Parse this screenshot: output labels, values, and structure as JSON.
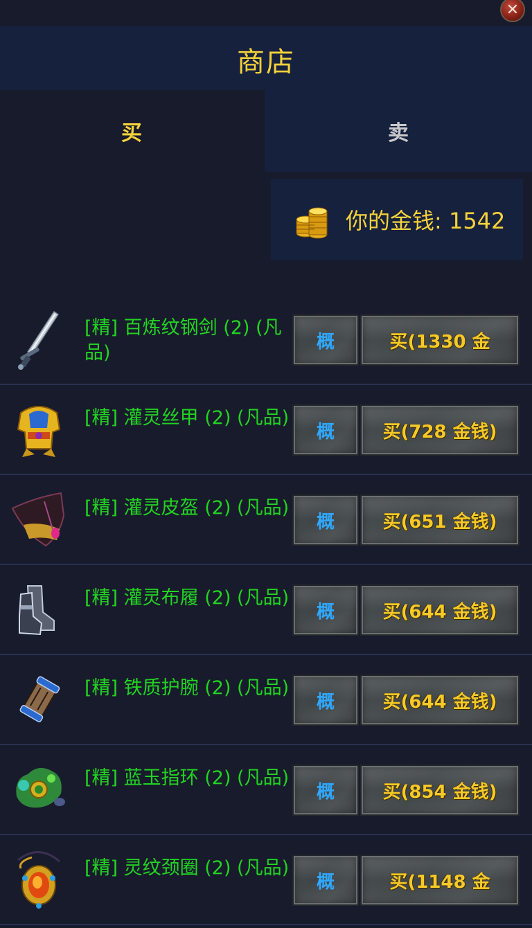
{
  "window": {
    "title": "商店",
    "close_icon": "close-x-icon"
  },
  "tabs": {
    "buy": "买",
    "sell": "卖"
  },
  "money": {
    "label": "你的金钱: 1542",
    "icon": "gold-coins-icon"
  },
  "items": [
    {
      "name": "品)",
      "detail_label": "",
      "buy_label": "",
      "icon": "amber-gem-icon"
    },
    {
      "name": "[精] 百炼纹钢剑 (2) (凡品)",
      "detail_label": "概",
      "buy_label": "买(1330 金",
      "icon": "sword-icon"
    },
    {
      "name": "[精] 灌灵丝甲 (2) (凡品)",
      "detail_label": "概",
      "buy_label": "买(728 金钱)",
      "icon": "golden-armor-icon"
    },
    {
      "name": "[精] 灌灵皮盔 (2) (凡品)",
      "detail_label": "概",
      "buy_label": "买(651 金钱)",
      "icon": "leather-helmet-icon"
    },
    {
      "name": "[精] 灌灵布履 (2) (凡品)",
      "detail_label": "概",
      "buy_label": "买(644 金钱)",
      "icon": "boots-icon"
    },
    {
      "name": "[精] 铁质护腕 (2) (凡品)",
      "detail_label": "概",
      "buy_label": "买(644 金钱)",
      "icon": "iron-bracer-icon"
    },
    {
      "name": "[精] 蓝玉指环 (2) (凡品)",
      "detail_label": "概",
      "buy_label": "买(854 金钱)",
      "icon": "jade-ring-icon"
    },
    {
      "name": "[精] 灵纹颈圈 (2) (凡品)",
      "detail_label": "概",
      "buy_label": "买(1148 金",
      "icon": "amulet-icon"
    }
  ],
  "colors": {
    "background": "#181b2c",
    "panel": "#16213d",
    "title": "#f6d23a",
    "item_name": "#22d422",
    "detail_button_text": "#2fa8ff",
    "buy_button_text": "#f6c928"
  }
}
